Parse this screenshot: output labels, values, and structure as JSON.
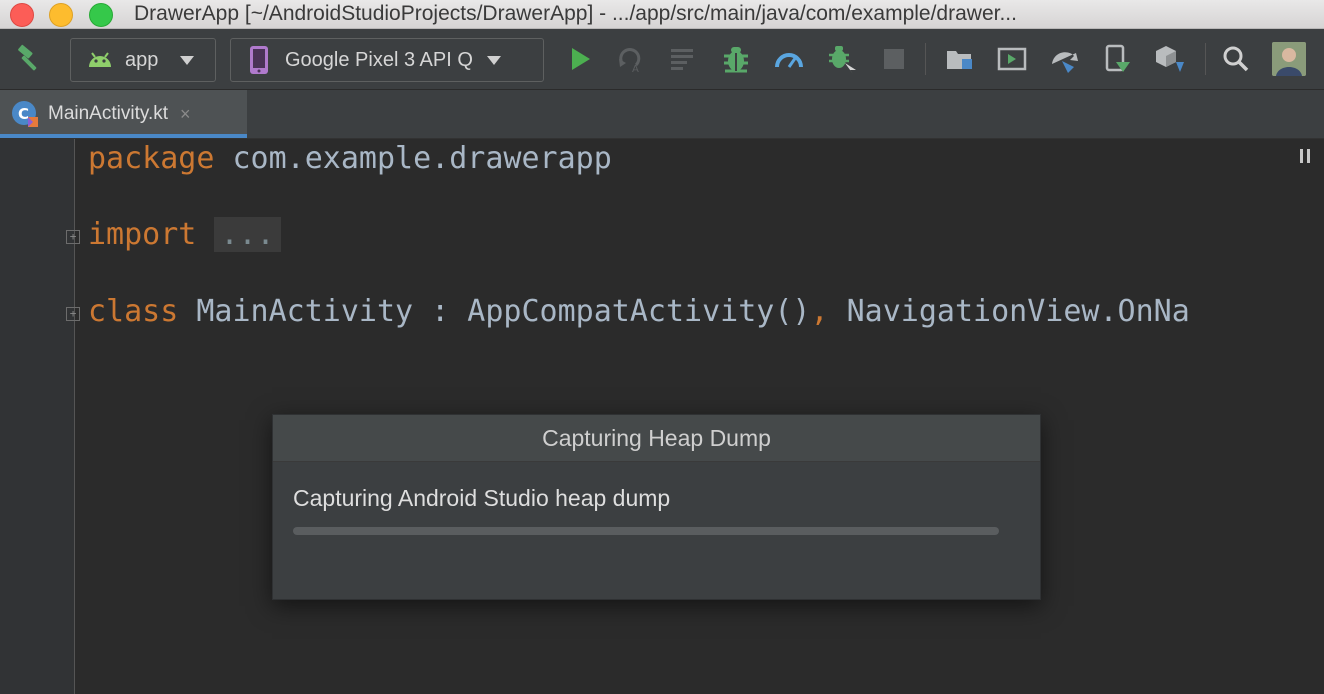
{
  "window": {
    "title": "DrawerApp [~/AndroidStudioProjects/DrawerApp] - .../app/src/main/java/com/example/drawer..."
  },
  "toolbar": {
    "build_icon": "hammer-icon",
    "module_combo": {
      "label": "app",
      "icon": "android-icon"
    },
    "device_combo": {
      "label": "Google Pixel 3 API Q",
      "icon": "phone-icon"
    },
    "colors": {
      "run": "#4caf50",
      "debug": "#59a869",
      "profiler": "#5aa6e0"
    }
  },
  "tabs": [
    {
      "label": "MainActivity.kt",
      "icon": "kotlin-file-icon",
      "close": "×",
      "active": true
    }
  ],
  "editor": {
    "line1": {
      "keyword": "package",
      "text": " com.example.drawerapp"
    },
    "line2": {
      "keyword": "import",
      "text": " ",
      "folded": "..."
    },
    "line3": {
      "keyword": "class",
      "text": " MainActivity : AppCompatActivity()",
      "comma": ",",
      "tail": " NavigationView.OnNa"
    },
    "fold_marker": "+",
    "keyword_color": "#cc7832"
  },
  "dialog": {
    "title": "Capturing Heap Dump",
    "message": "Capturing Android Studio heap dump",
    "progress": 0
  }
}
